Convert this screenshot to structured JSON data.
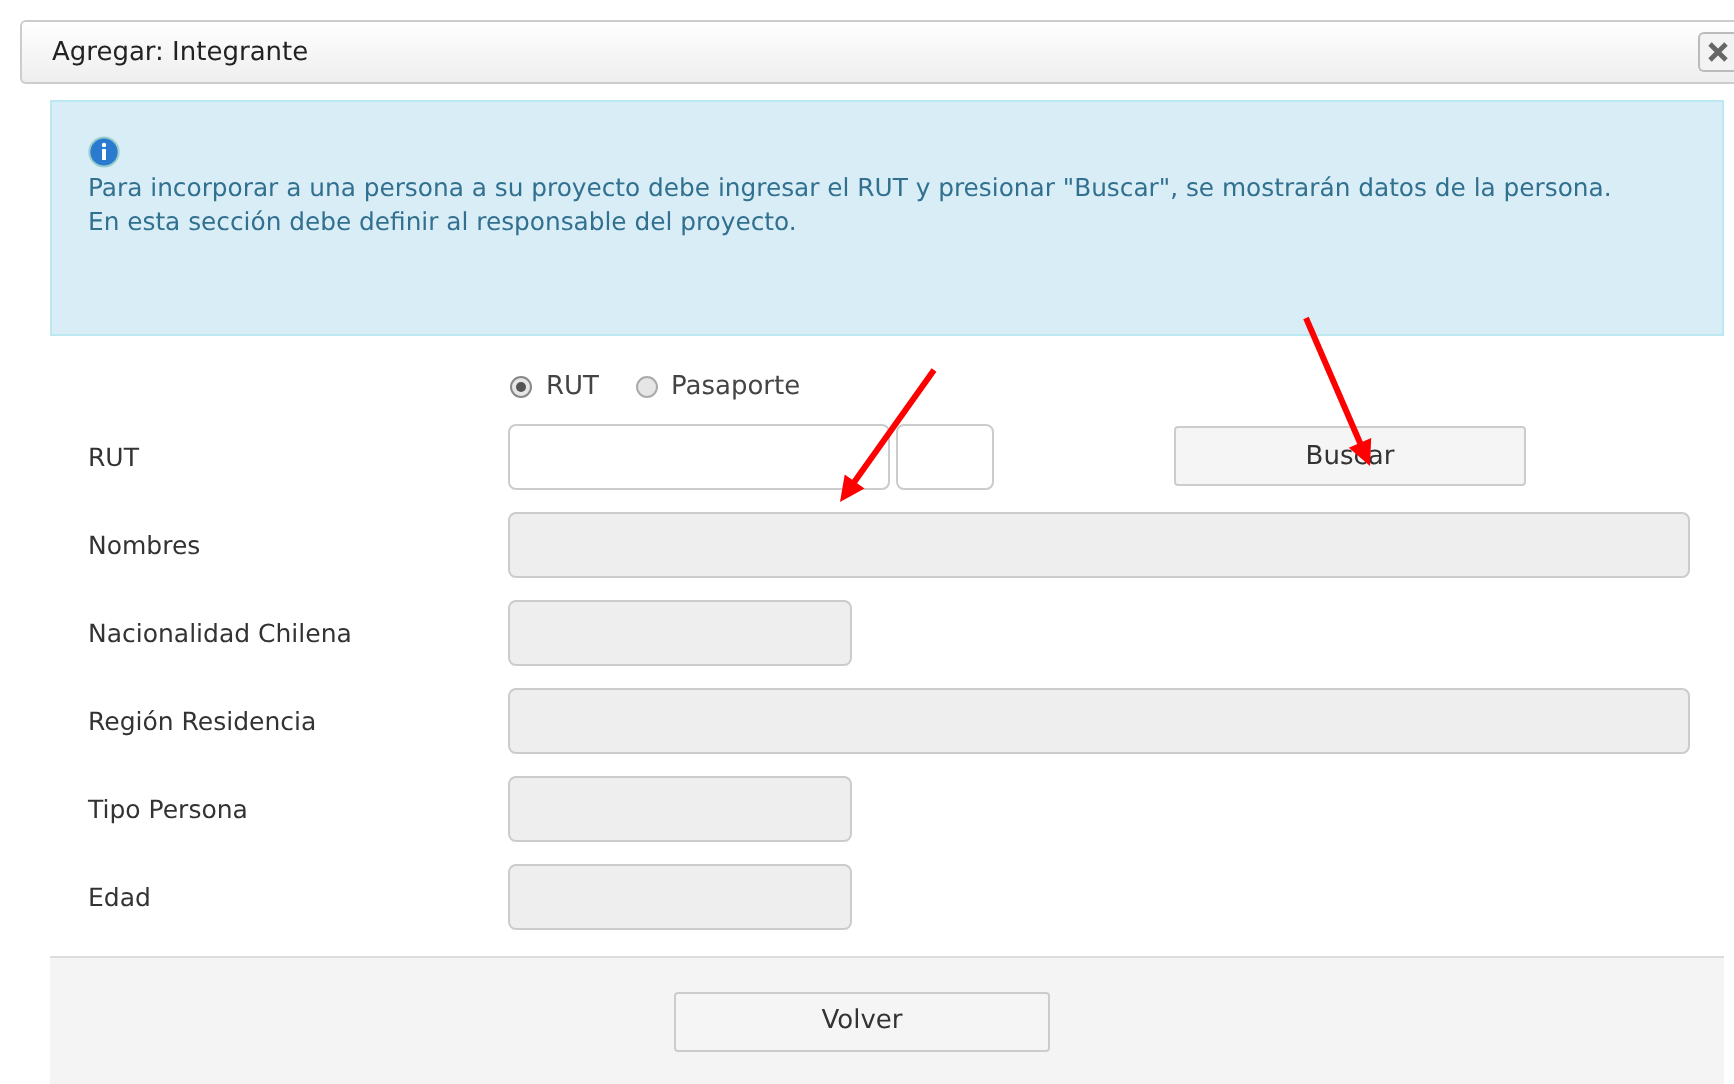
{
  "dialog": {
    "title": "Agregar: Integrante"
  },
  "info": {
    "lines": [
      "Para incorporar a una persona a su proyecto debe ingresar el RUT y presionar \"Buscar\", se mostrarán datos de la persona.",
      "En esta sección debe definir al responsable del proyecto."
    ]
  },
  "id_type": [
    {
      "label": "RUT",
      "selected": true
    },
    {
      "label": "Pasaporte",
      "selected": false
    }
  ],
  "rut_row": {
    "label": "RUT",
    "button": "Buscar"
  },
  "fields": [
    {
      "label": "Nombres",
      "kind": "wide",
      "disabled": true
    },
    {
      "label": "Nacionalidad Chilena",
      "kind": "short",
      "disabled": true
    },
    {
      "label": "Región Residencia",
      "kind": "wide",
      "disabled": true
    },
    {
      "label": "Tipo Persona",
      "kind": "short",
      "disabled": true
    },
    {
      "label": "Edad",
      "kind": "short",
      "disabled": true
    }
  ],
  "footer": {
    "button": "Volver"
  }
}
